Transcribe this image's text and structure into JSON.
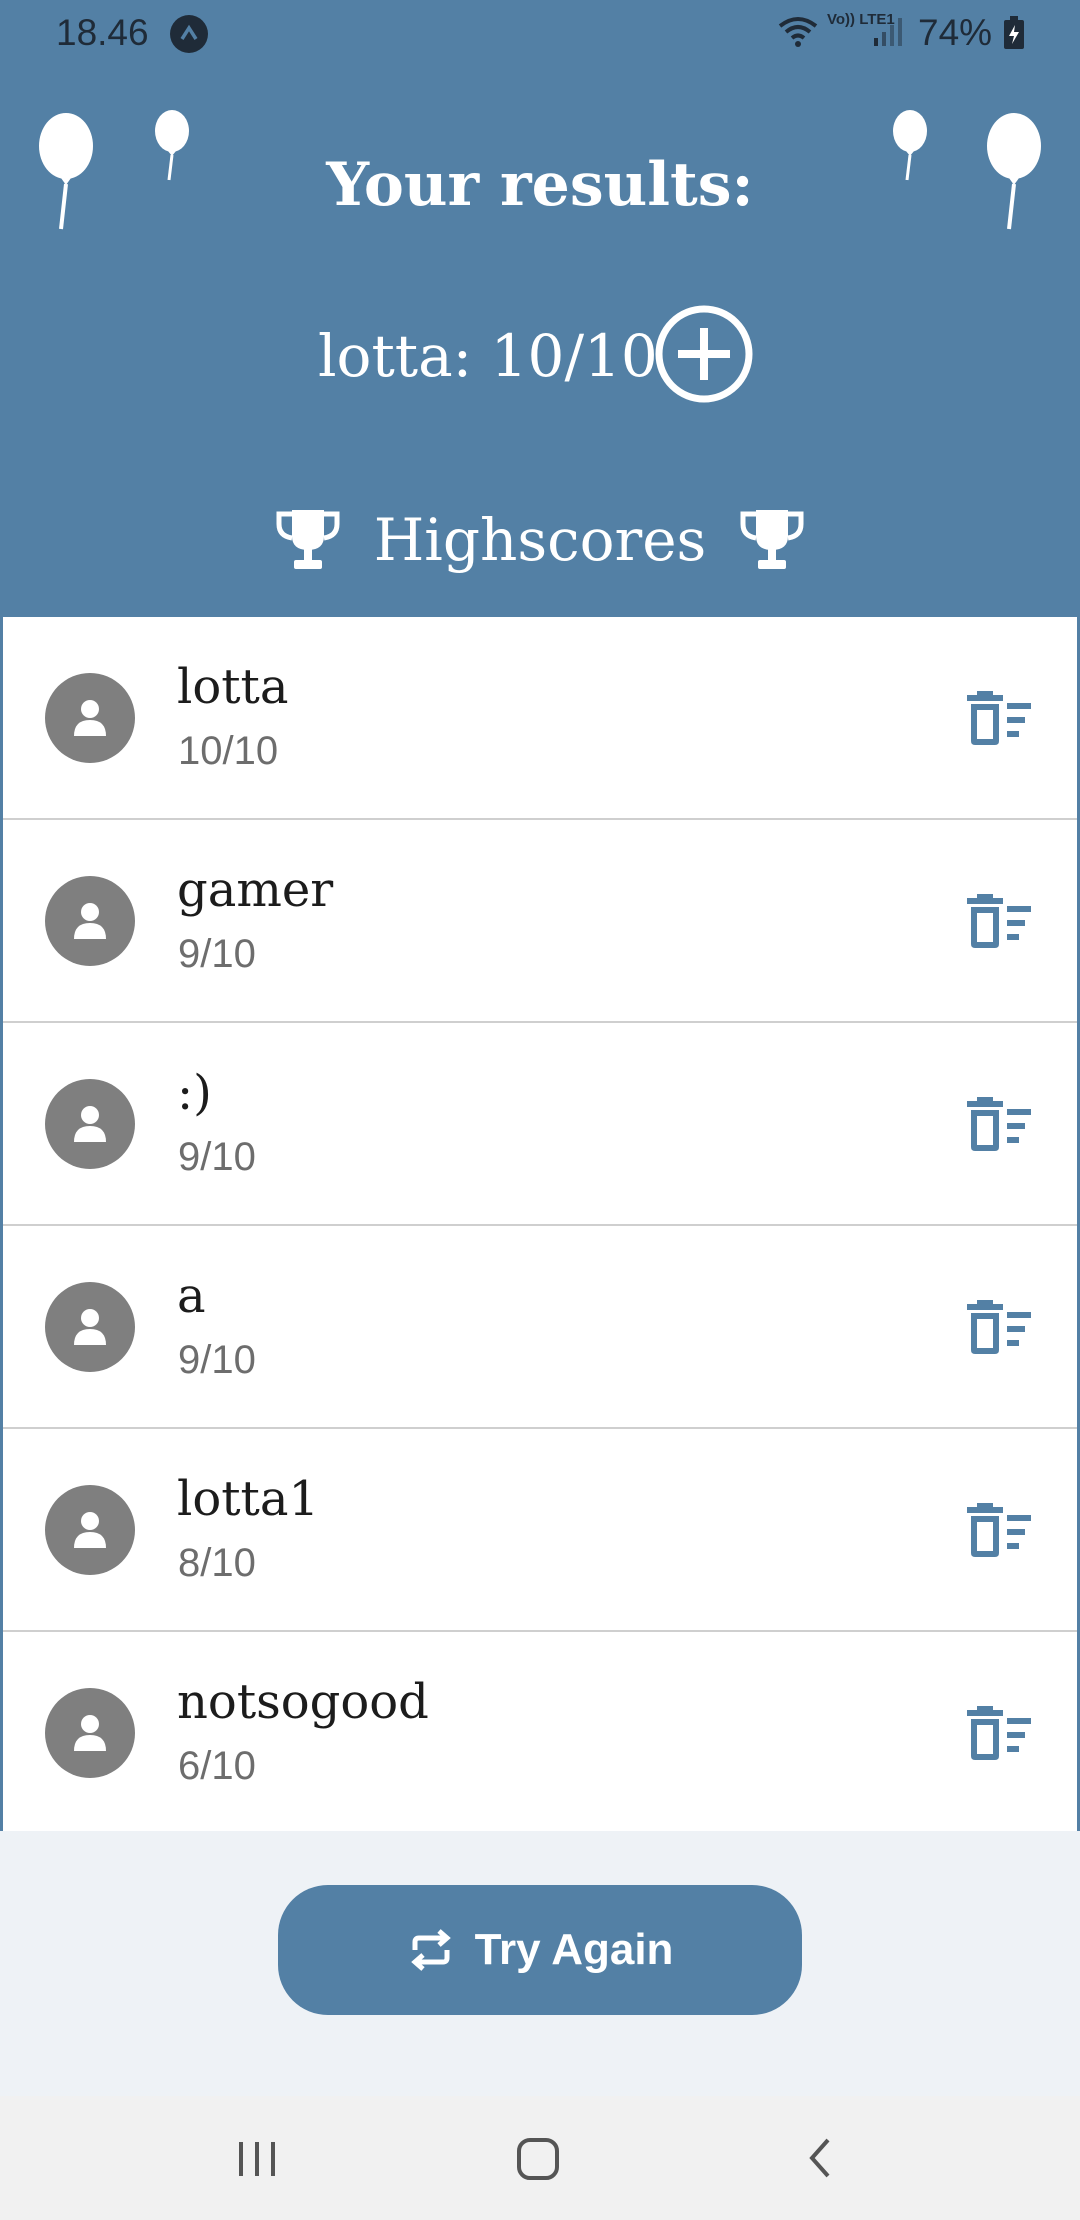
{
  "status_bar": {
    "time": "18.46",
    "network_label": "Vo)) LTE1",
    "battery": "74%"
  },
  "header": {
    "title": "Your results:",
    "current_score": "lotta: 10/10",
    "highscores_label": "Highscores"
  },
  "highscores": [
    {
      "name": "lotta",
      "score": "10/10"
    },
    {
      "name": "gamer",
      "score": "9/10"
    },
    {
      "name": ":)",
      "score": "9/10"
    },
    {
      "name": "a",
      "score": "9/10"
    },
    {
      "name": "lotta1",
      "score": "8/10"
    },
    {
      "name": "notsogood",
      "score": "6/10"
    }
  ],
  "actions": {
    "try_again_label": "Try Again"
  },
  "icons": {
    "add": "plus-circle-icon",
    "trophy": "trophy-icon",
    "avatar": "person-icon",
    "delete": "delete-sweep-icon",
    "repeat": "repeat-icon",
    "balloon": "balloon-icon"
  },
  "colors": {
    "primary": "#5380a5",
    "background": "#eef2f6",
    "avatar": "#7f7f7f",
    "divider": "#cfcfcf"
  }
}
